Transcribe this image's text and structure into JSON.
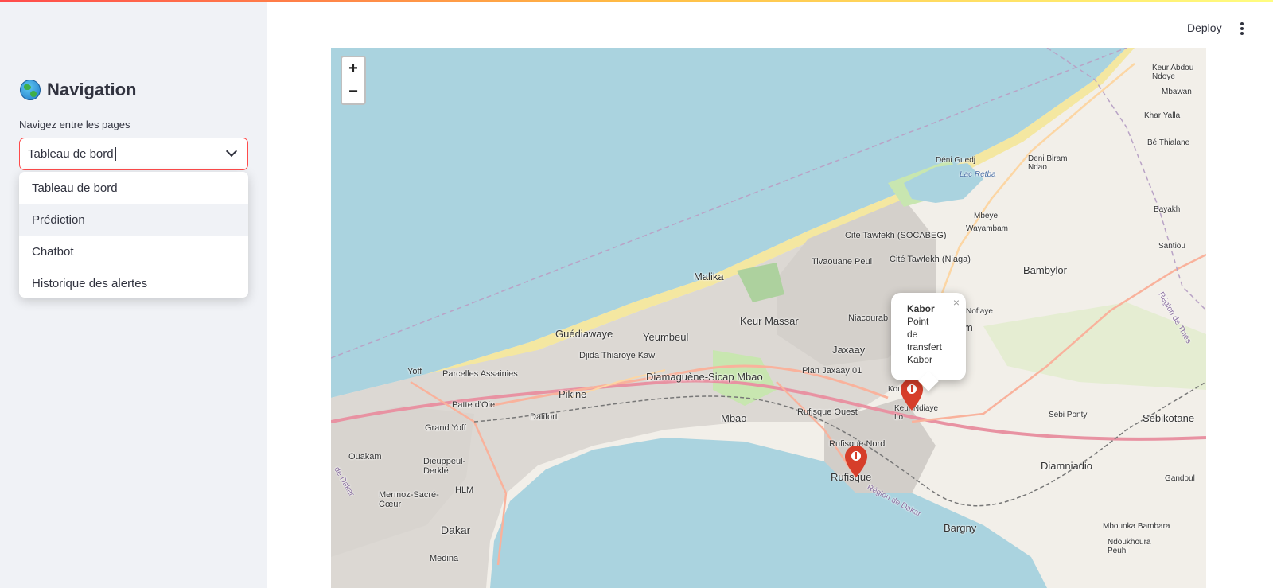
{
  "sidebar": {
    "title": "Navigation",
    "select_label": "Navigez entre les pages",
    "select_value": "Tableau de bord",
    "options": [
      "Tableau de bord",
      "Prédiction",
      "Chatbot",
      "Historique des alertes"
    ]
  },
  "header": {
    "deploy_label": "Deploy"
  },
  "map": {
    "zoom_in": "+",
    "zoom_out": "−",
    "popup": {
      "title": "Kabor",
      "line1": "Point",
      "line2": "de",
      "line3": "transfert",
      "line4": "Kabor",
      "close": "×"
    },
    "labels": {
      "cite_tawfekh_socabeg": "Cité Tawfekh (SOCABEG)",
      "cite_tawfekh_niaga": "Cité Tawfekh (Niaga)",
      "tivaouane_peul": "Tivaouane Peul",
      "malika": "Malika",
      "keur_massar": "Keur Massar",
      "niacourab": "Niacourab",
      "jaxaay": "Jaxaay",
      "plan_jaxaay": "Plan Jaxaay 01",
      "guediawaye": "Guédiawaye",
      "yeumbeul": "Yeumbeul",
      "djida_thiaroye_kaw": "Djida Thiaroye Kaw",
      "diamaguene": "Diamaguène-Sicap Mbao",
      "yoff": "Yoff",
      "parcelles": "Parcelles Assainies",
      "pikine": "Pikine",
      "patte_doie": "Patte d'Oie",
      "dalifort": "Dalifort",
      "mbao": "Mbao",
      "rufisque_ouest": "Rufisque Ouest",
      "rufisque_nord": "Rufisque Nord",
      "rufisque": "Rufisque",
      "grand_yoff": "Grand Yoff",
      "ouakam": "Ouakam",
      "dieuppeul": "Dieuppeul-Derklé",
      "hlm": "HLM",
      "mermoz": "Mermoz-Sacré-Cœur",
      "dakar": "Dakar",
      "medina": "Medina",
      "kounoune": "Kounou",
      "keur_ndiaye_lo": "Keur Ndiaye Lo",
      "bambylor": "Bambylor",
      "deni_guedj": "Déni Guedj",
      "lac_retba": "Lac Retba",
      "deni_biram_ndao": "Deni Biram Ndao",
      "mbeye": "Mbeye",
      "wayambam": "Wayambam",
      "noflaye": "Noflaye",
      "sangalkam": "alkam",
      "bayakh": "Bayakh",
      "santiou": "Santiou",
      "keur_abdou_ndoye": "Keur Abdou Ndoye",
      "mbawane": "Mbawan",
      "khar_yalla": "Khar Yalla",
      "be_thialane": "Bé Thialane",
      "region_thies": "Région de Thiès",
      "sebi_ponty": "Sebi Ponty",
      "sebikotane": "Sebikotane",
      "diamniadio": "Diamniadio",
      "bargny": "Bargny",
      "gandoul": "Gandoul",
      "mbounka_bambara": "Mbounka Bambara",
      "ndoukhoura_peuhl": "Ndoukhoura Peuhl",
      "region_dakar": "Région de Dakar",
      "region_de_dakar_left": "de Dakar",
      "boudou": "udou",
      "se": "se"
    }
  }
}
